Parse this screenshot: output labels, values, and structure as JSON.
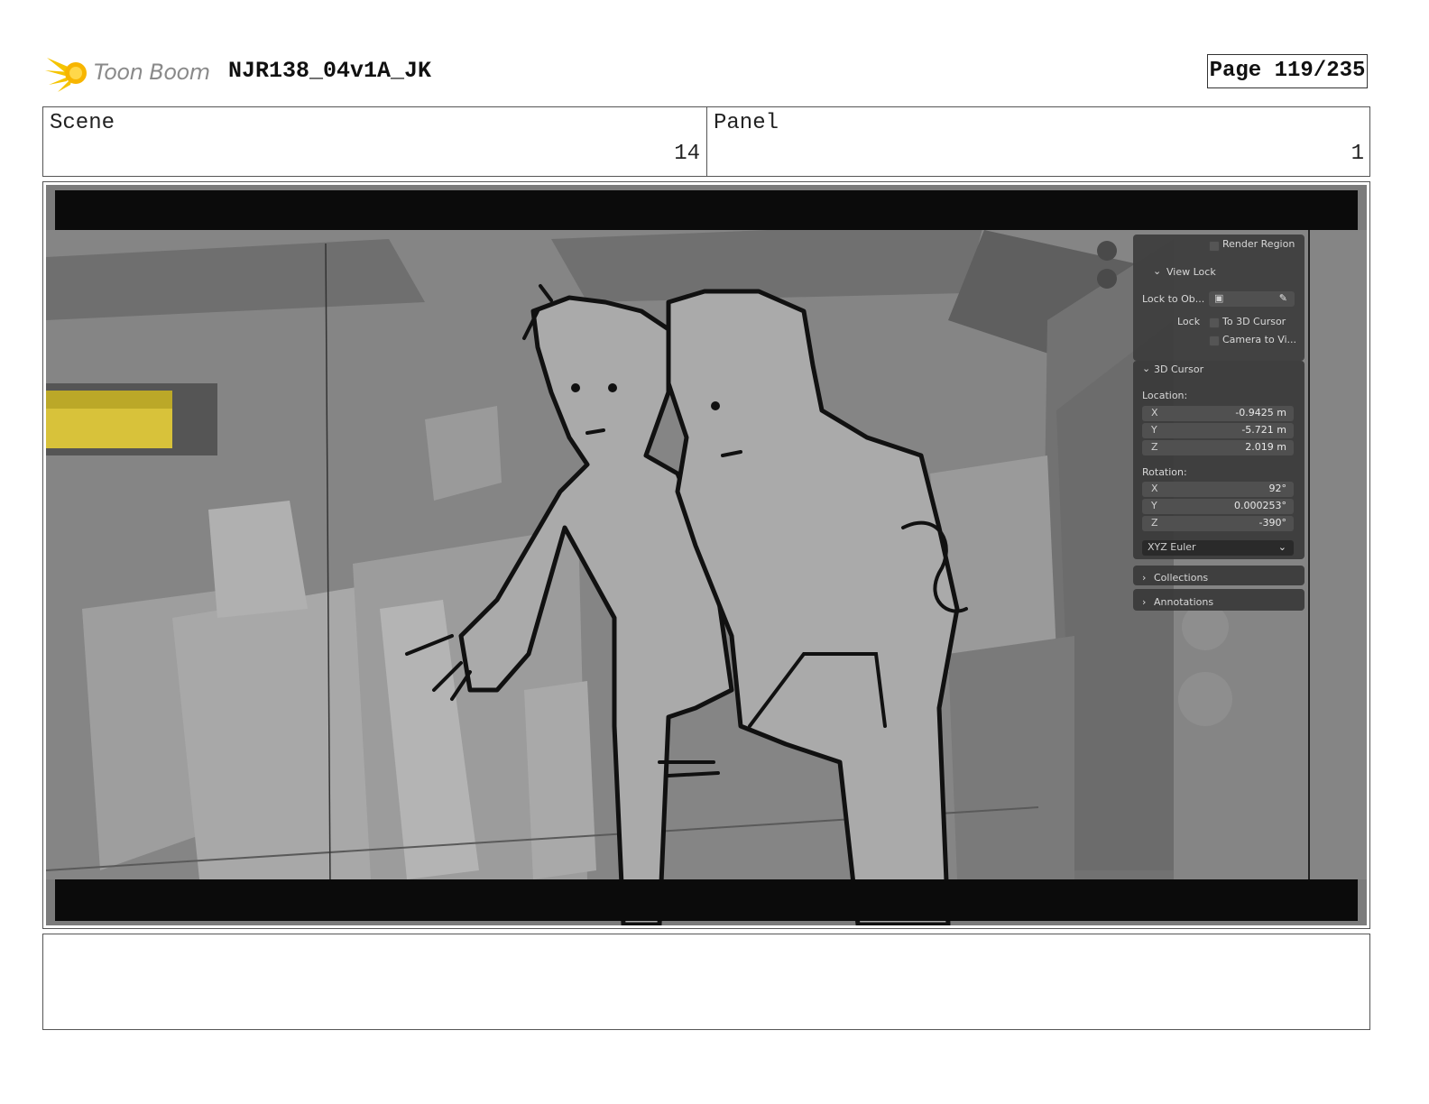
{
  "header": {
    "logo_text": "Toon Boom",
    "doc_title": "NJR138_04v1A_JK",
    "page_label": "Page 119/235"
  },
  "info": {
    "scene_label": "Scene",
    "scene_value": "14",
    "panel_label": "Panel",
    "panel_value": "1"
  },
  "blender_sidebar": {
    "render_region": "Render Region",
    "view_lock": "View Lock",
    "lock_to_object": "Lock to Ob...",
    "lock": "Lock",
    "to_3d_cursor": "To 3D Cursor",
    "camera_to_view": "Camera to Vi...",
    "cursor_header": "3D Cursor",
    "location_label": "Location:",
    "location": [
      {
        "axis": "X",
        "value": "-0.9425 m"
      },
      {
        "axis": "Y",
        "value": "-5.721 m"
      },
      {
        "axis": "Z",
        "value": "2.019 m"
      }
    ],
    "rotation_label": "Rotation:",
    "rotation": [
      {
        "axis": "X",
        "value": "92°"
      },
      {
        "axis": "Y",
        "value": "0.000253°"
      },
      {
        "axis": "Z",
        "value": "-390°"
      }
    ],
    "rotation_mode": "XYZ Euler",
    "collections": "Collections",
    "annotations": "Annotations"
  },
  "notes": {
    "text": ""
  }
}
